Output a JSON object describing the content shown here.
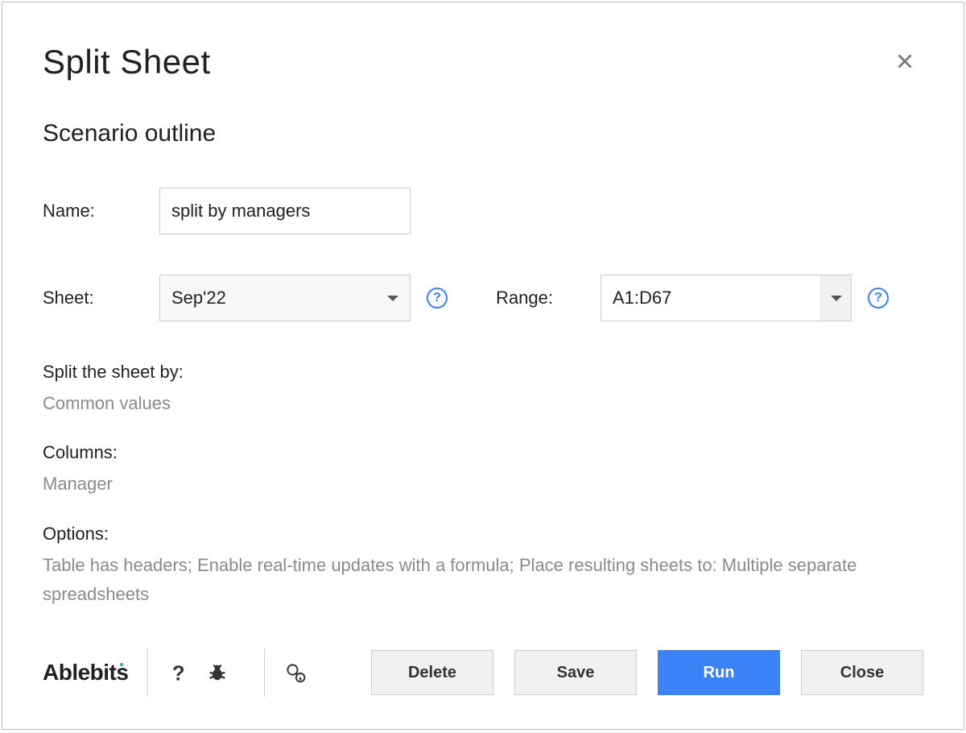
{
  "dialog": {
    "title": "Split Sheet",
    "subtitle": "Scenario outline"
  },
  "form": {
    "name_label": "Name:",
    "name_value": "split by managers",
    "sheet_label": "Sheet:",
    "sheet_value": "Sep'22",
    "range_label": "Range:",
    "range_value": "A1:D67"
  },
  "summary": {
    "split_by_label": "Split the sheet by:",
    "split_by_value": "Common values",
    "columns_label": "Columns:",
    "columns_value": "Manager",
    "options_label": "Options:",
    "options_value": "Table has headers; Enable real-time updates with a formula; Place resulting sheets to: Multiple separate spreadsheets"
  },
  "footer": {
    "brand": "Ablebits",
    "delete": "Delete",
    "save": "Save",
    "run": "Run",
    "close": "Close"
  }
}
